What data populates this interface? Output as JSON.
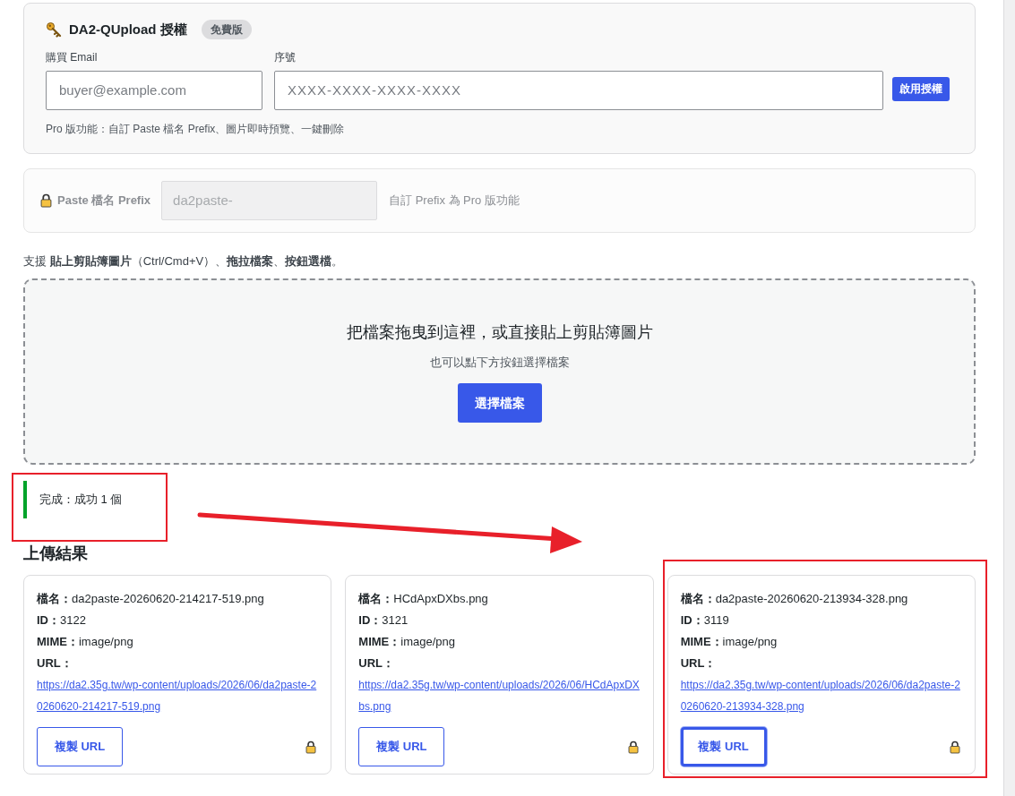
{
  "license": {
    "title": "DA2-QUpload 授權",
    "badge": "免費版",
    "email_label": "購買 Email",
    "email_placeholder": "buyer@example.com",
    "serial_label": "序號",
    "serial_placeholder": "XXXX-XXXX-XXXX-XXXX",
    "activate_button": "啟用授權",
    "note": "Pro 版功能：自訂 Paste 檔名 Prefix、圖片即時預覽、一鍵刪除"
  },
  "prefix": {
    "label": "Paste 檔名 Prefix",
    "value": "da2paste-",
    "disabled": true,
    "note": "自訂 Prefix 為 Pro 版功能"
  },
  "support_text": "支援 **貼上剪貼簿圖片**（Ctrl/Cmd+V）、**拖拉檔案**、**按鈕選檔**。",
  "dropzone": {
    "title": "把檔案拖曳到這裡，或直接貼上剪貼簿圖片",
    "subtitle": "也可以點下方按鈕選擇檔案",
    "button": "選擇檔案"
  },
  "status": {
    "text": "完成：成功 1 個",
    "highlighted": true
  },
  "annotation_arrow": true,
  "results_title": "上傳結果",
  "results": [
    {
      "name": "**檔名：**da2paste-20260620-214217-519.png",
      "id": "**ID：**3122",
      "mime": "**MIME：**image/png",
      "url_label": "URL：",
      "url": "https://da2.35g.tw/wp-content/uploads/2026/06/da2paste-20260620-214217-519.png",
      "button": "複製 URL",
      "focused": false,
      "highlighted": false
    },
    {
      "name": "**檔名：**HCdApxDXbs.png",
      "id": "**ID：**3121",
      "mime": "**MIME：**image/png",
      "url_label": "URL：",
      "url": "https://da2.35g.tw/wp-content/uploads/2026/06/HCdApxDXbs.png",
      "button": "複製 URL",
      "focused": false,
      "highlighted": false
    },
    {
      "name": "**檔名：**da2paste-20260620-213934-328.png",
      "id": "**ID：**3119",
      "mime": "**MIME：**image/png",
      "url_label": "URL：",
      "url": "https://da2.35g.tw/wp-content/uploads/2026/06/da2paste-20260620-213934-328.png",
      "button": "複製 URL",
      "focused": true,
      "highlighted": true
    }
  ]
}
